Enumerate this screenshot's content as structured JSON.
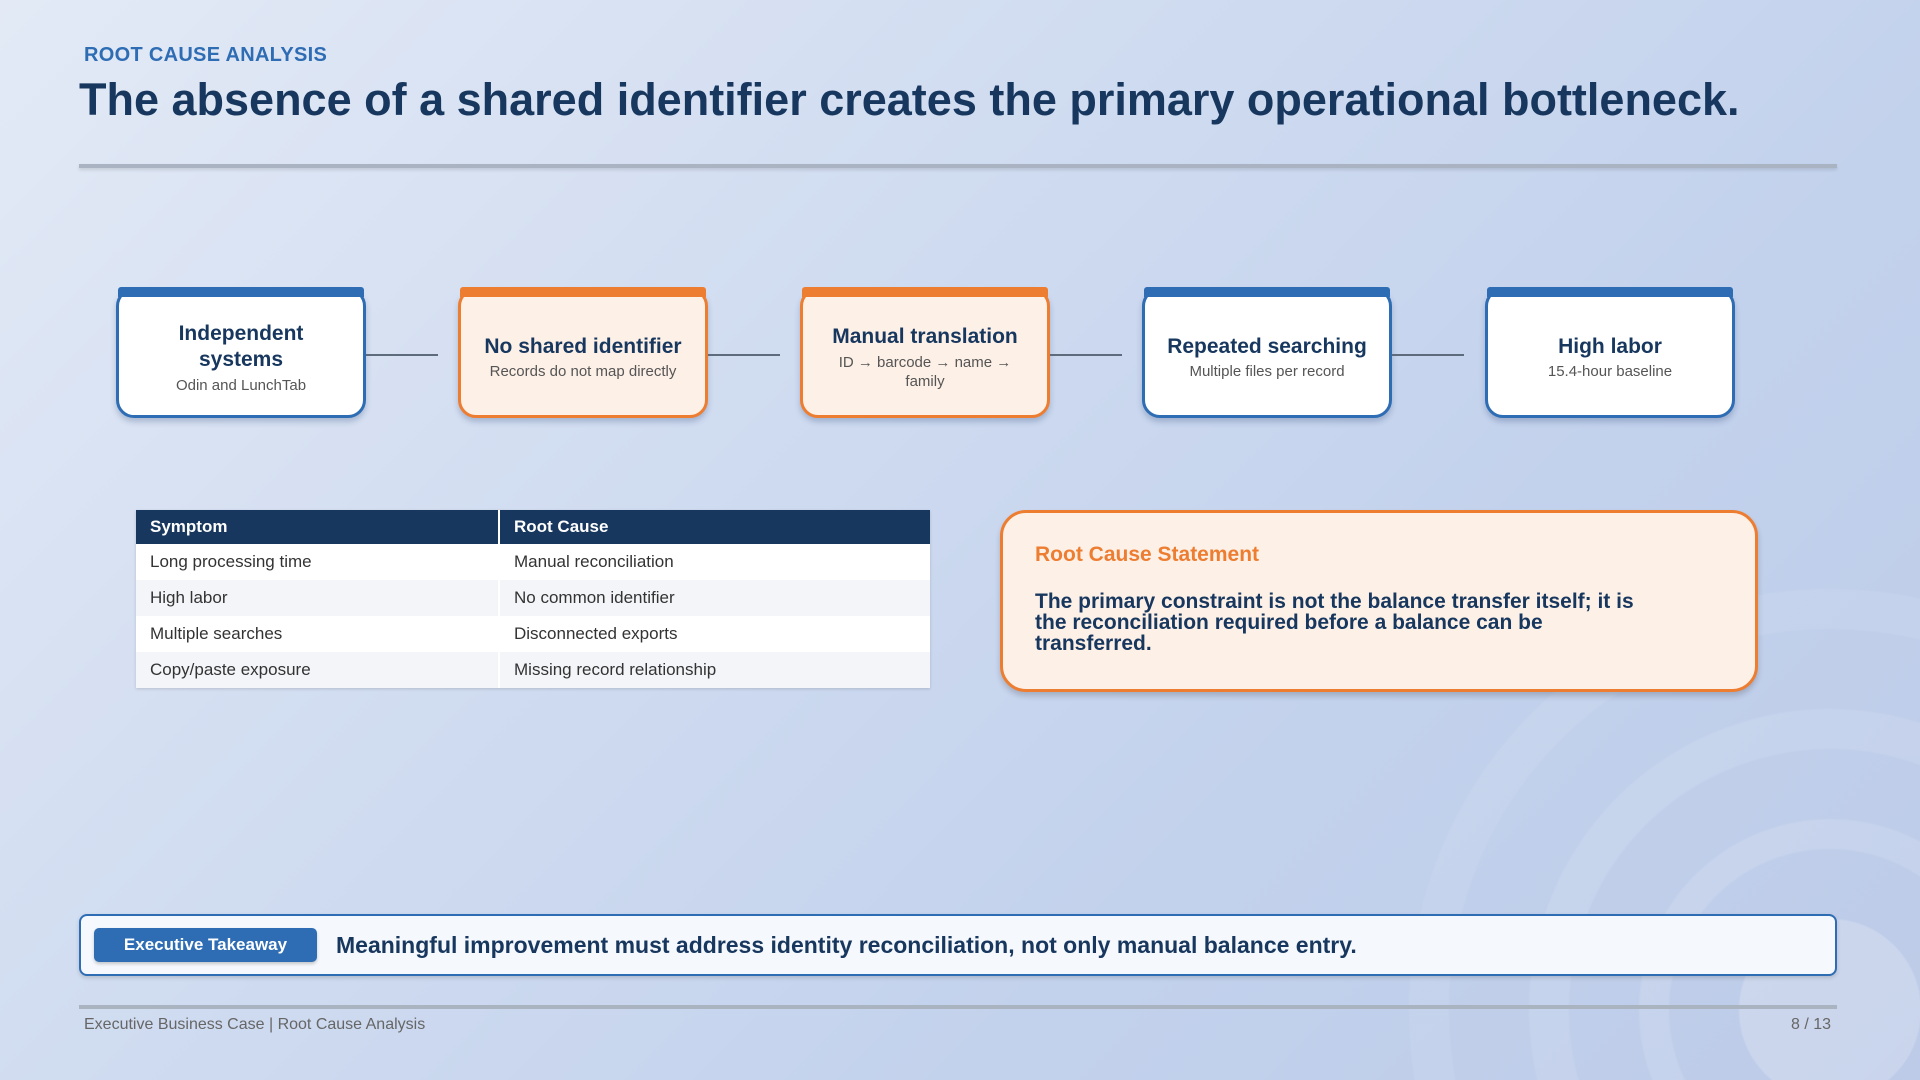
{
  "header": {
    "kicker": "ROOT CAUSE ANALYSIS",
    "title": "The absence of a shared identifier creates the primary operational bottleneck."
  },
  "flow": [
    {
      "title": "Independent systems",
      "subtitle": "Odin and LunchTab",
      "accent": "#2e6db4"
    },
    {
      "title": "No shared identifier",
      "subtitle": "Records do not map directly",
      "accent": "#ed7d31"
    },
    {
      "title": "Manual translation",
      "subtitle": "ID → barcode → name → family",
      "accent": "#ed7d31"
    },
    {
      "title": "Repeated searching",
      "subtitle": "Multiple files per record",
      "accent": "#2e6db4"
    },
    {
      "title": "High labor",
      "subtitle": "15.4-hour baseline",
      "accent": "#2e6db4"
    }
  ],
  "table": {
    "headers": [
      "Symptom",
      "Root Cause"
    ],
    "rows": [
      [
        "Long processing time",
        "Manual reconciliation"
      ],
      [
        "High labor",
        "No common identifier"
      ],
      [
        "Multiple searches",
        "Disconnected exports"
      ],
      [
        "Copy/paste exposure",
        "Missing record relationship"
      ]
    ]
  },
  "statement": {
    "title": "Root Cause Statement",
    "text": "The primary constraint is not the balance transfer itself; it is the reconciliation required before a balance can be transferred."
  },
  "takeaway": {
    "badge": "Executive Takeaway",
    "text": "Meaningful improvement must address identity reconciliation, not only manual balance entry."
  },
  "footer": {
    "left": "Executive Business Case | Root Cause Analysis",
    "right": "8 / 13"
  },
  "colors": {
    "navy": "#17375e",
    "blue": "#2e6db4",
    "orange": "#ed7d31"
  }
}
